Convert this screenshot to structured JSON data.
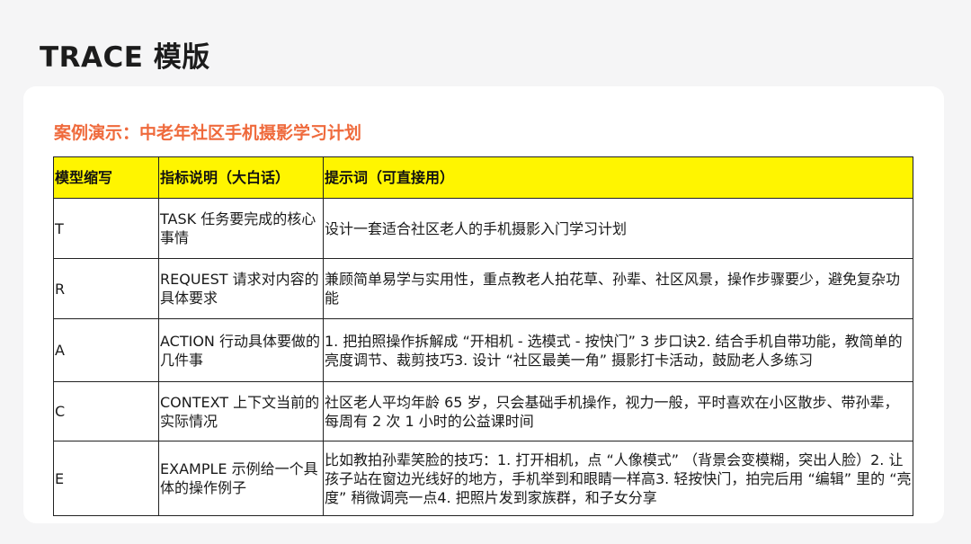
{
  "header": {
    "title": "TRACE 模版"
  },
  "card": {
    "subtitle": "案例演示：中老年社区手机摄影学习计划"
  },
  "table": {
    "columns": [
      "模型缩写",
      "指标说明（大白话）",
      "提示词（可直接用）"
    ],
    "rows": [
      {
        "abbr": "T",
        "desc": "TASK 任务要完成的核心事情",
        "prompt": "设计一套适合社区老人的手机摄影入门学习计划"
      },
      {
        "abbr": "R",
        "desc": "REQUEST 请求对内容的具体要求",
        "prompt": "兼顾简单易学与实用性，重点教老人拍花草、孙辈、社区风景，操作步骤要少，避免复杂功能"
      },
      {
        "abbr": "A",
        "desc": "ACTION 行动具体要做的几件事",
        "prompt": "1. 把拍照操作拆解成 “开相机 - 选模式 - 按快门” 3 步口诀2. 结合手机自带功能，教简单的亮度调节、裁剪技巧3. 设计 “社区最美一角” 摄影打卡活动，鼓励老人多练习"
      },
      {
        "abbr": "C",
        "desc": "CONTEXT 上下文当前的实际情况",
        "prompt": "社区老人平均年龄 65 岁，只会基础手机操作，视力一般，平时喜欢在小区散步、带孙辈，每周有 2 次 1 小时的公益课时间"
      },
      {
        "abbr": "E",
        "desc": "EXAMPLE 示例给一个具体的操作例子",
        "prompt": "比如教拍孙辈笑脸的技巧：1. 打开相机，点 “人像模式” （背景会变模糊，突出人脸）2. 让孩子站在窗边光线好的地方，手机举到和眼睛一样高3. 轻按快门，拍完后用 “编辑” 里的 “亮度” 稍微调亮一点4. 把照片发到家族群，和子女分享"
      }
    ]
  },
  "colors": {
    "background": "#f5f5f6",
    "card": "#ffffff",
    "subtitle": "#ef6a3c",
    "header_row": "#fff500",
    "border": "#222222"
  }
}
